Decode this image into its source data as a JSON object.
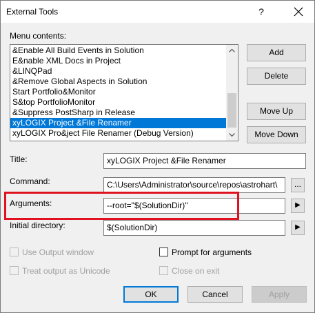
{
  "window": {
    "title": "External Tools",
    "help_glyph": "?",
    "close_icon": "close-icon"
  },
  "menu_contents_label": "Menu contents:",
  "menu_items": [
    "&Enable All Build Events in Solution",
    "E&nable XML Docs in Project",
    "&LINQPad",
    "&Remove Global Aspects in Solution",
    "Start Portfolio&Monitor",
    "S&top PortfolioMonitor",
    "&Suppress PostSharp in Release",
    "xyLOGIX Project &File Renamer",
    "xyLOGIX Pro&ject File Renamer (Debug Version)"
  ],
  "selected_index": 7,
  "buttons": {
    "add": "Add",
    "delete": "Delete",
    "move_up": "Move Up",
    "move_down": "Move Down",
    "ok": "OK",
    "cancel": "Cancel",
    "apply": "Apply",
    "browse": "...",
    "arguments_menu": "▶",
    "initial_dir_menu": "▶"
  },
  "fields": {
    "title_label": "Title:",
    "title_value": "xyLOGIX Project &File Renamer",
    "command_label": "Command:",
    "command_value": "C:\\Users\\Administrator\\source\\repos\\astrohart\\",
    "arguments_label": "Arguments:",
    "arguments_value": "--root=\"$(SolutionDir)\"",
    "initial_dir_label": "Initial directory:",
    "initial_dir_value": "$(SolutionDir)"
  },
  "options": {
    "use_output_window": "Use Output window",
    "prompt_for_arguments": "Prompt for arguments",
    "treat_output_unicode": "Treat output as Unicode",
    "close_on_exit": "Close on exit"
  },
  "colors": {
    "selection": "#0078d7",
    "highlight_box": "#e0121f"
  }
}
